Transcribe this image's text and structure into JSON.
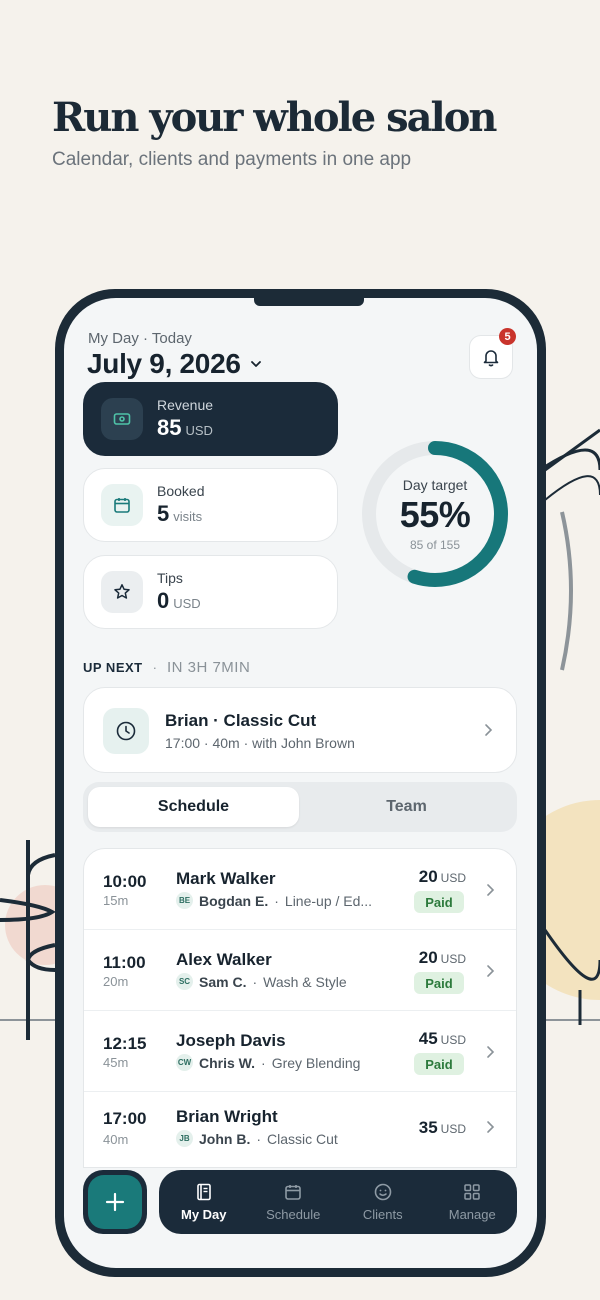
{
  "marketing": {
    "headline": "Run your whole salon",
    "subline": "Calendar, clients and payments in one app"
  },
  "header": {
    "eyebrow": "My Day · Today",
    "date": "July 9, 2026",
    "notifications_count": "5"
  },
  "stats": {
    "revenue": {
      "label": "Revenue",
      "value": "85",
      "unit": "USD"
    },
    "booked": {
      "label": "Booked",
      "value": "5",
      "unit": "visits"
    },
    "tips": {
      "label": "Tips",
      "value": "0",
      "unit": "USD"
    }
  },
  "day_target": {
    "label": "Day target",
    "percent_text": "55%",
    "sub": "85 of 155",
    "progress": 0.55
  },
  "up_next": {
    "label": "UP NEXT",
    "separator": "·",
    "eta": "IN 3H 7MIN",
    "title": "Brian · Classic Cut",
    "subtitle": "17:00 · 40m · with John Brown"
  },
  "segments": {
    "schedule": "Schedule",
    "team": "Team"
  },
  "appointments": [
    {
      "time": "10:00",
      "duration": "15m",
      "client": "Mark Walker",
      "initials": "BE",
      "staff": "Bogdan E.",
      "service": "Line-up / Ed...",
      "price": "20",
      "unit": "USD",
      "status": "Paid"
    },
    {
      "time": "11:00",
      "duration": "20m",
      "client": "Alex Walker",
      "initials": "SC",
      "staff": "Sam C.",
      "service": "Wash & Style",
      "price": "20",
      "unit": "USD",
      "status": "Paid"
    },
    {
      "time": "12:15",
      "duration": "45m",
      "client": "Joseph Davis",
      "initials": "CW",
      "staff": "Chris W.",
      "service": "Grey Blending",
      "price": "45",
      "unit": "USD",
      "status": "Paid"
    },
    {
      "time": "17:00",
      "duration": "40m",
      "client": "Brian Wright",
      "initials": "JB",
      "staff": "John B.",
      "service": "Classic Cut",
      "price": "35",
      "unit": "USD",
      "status": ""
    }
  ],
  "meta_separator": "·",
  "tabbar": {
    "items": [
      {
        "label": "My Day",
        "icon": "journal-icon"
      },
      {
        "label": "Schedule",
        "icon": "calendar-icon"
      },
      {
        "label": "Clients",
        "icon": "smile-icon"
      },
      {
        "label": "Manage",
        "icon": "grid-icon"
      }
    ]
  },
  "colors": {
    "accent": "#1a7a7a",
    "dark": "#1b2b3a",
    "background": "#f5f2ec",
    "paid_bg": "#dff1e1",
    "badge": "#c9342c"
  }
}
